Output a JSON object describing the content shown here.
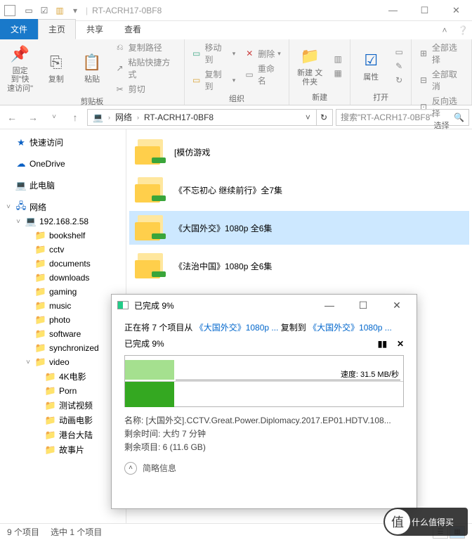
{
  "window": {
    "title": "RT-ACRH17-0BF8"
  },
  "tabs": {
    "file": "文件",
    "home": "主页",
    "share": "共享",
    "view": "查看"
  },
  "ribbon": {
    "clipboard": {
      "pin": "固定到\"快\n速访问\"",
      "copy": "复制",
      "paste": "粘贴",
      "path": "复制路径",
      "shortcut": "粘贴快捷方式",
      "cut": "剪切",
      "label": "剪贴板"
    },
    "organize": {
      "moveto": "移动到",
      "copyto": "复制到",
      "delete": "删除",
      "rename": "重命名",
      "label": "组织"
    },
    "new": {
      "folder": "新建\n文件夹",
      "label": "新建"
    },
    "open": {
      "properties": "属性",
      "label": "打开"
    },
    "select": {
      "all": "全部选择",
      "none": "全部取消",
      "invert": "反向选择",
      "label": "选择"
    }
  },
  "address": {
    "net": "网络",
    "loc": "RT-ACRH17-0BF8",
    "search": "搜索\"RT-ACRH17-0BF8\""
  },
  "tree": {
    "quick": "快速访问",
    "onedrive": "OneDrive",
    "thispc": "此电脑",
    "network": "网络",
    "ip": "192.168.2.58",
    "folders": [
      "bookshelf",
      "cctv",
      "documents",
      "downloads",
      "gaming",
      "music",
      "photo",
      "software",
      "synchronized",
      "video"
    ],
    "video_sub": [
      "4K电影",
      "Porn",
      "测试视频",
      "动画电影",
      "港台大陆",
      "故事片"
    ]
  },
  "items": [
    "[模仿游戏",
    "《不忘初心 继续前行》全7集",
    "《大国外交》1080p 全6集",
    "《法治中国》1080p 全6集"
  ],
  "status": {
    "count": "9 个项目",
    "selected": "选中 1 个项目"
  },
  "dialog": {
    "title": "已完成 9%",
    "copying_prefix": "正在将 7 个项目从 ",
    "src": "《大国外交》1080p ...",
    "copying_mid": " 复制到 ",
    "dst": "《大国外交》1080p ...",
    "progress": "已完成 9%",
    "speed": "速度: 31.5 MB/秒",
    "name_label": "名称: ",
    "name": "[大国外交].CCTV.Great.Power.Diplomacy.2017.EP01.HDTV.108...",
    "remain_label": "剩余时间: ",
    "remain": "大约 7 分钟",
    "items_label": "剩余项目: ",
    "items": "6 (11.6 GB)",
    "more": "简略信息"
  },
  "watermark": "什么值得买"
}
